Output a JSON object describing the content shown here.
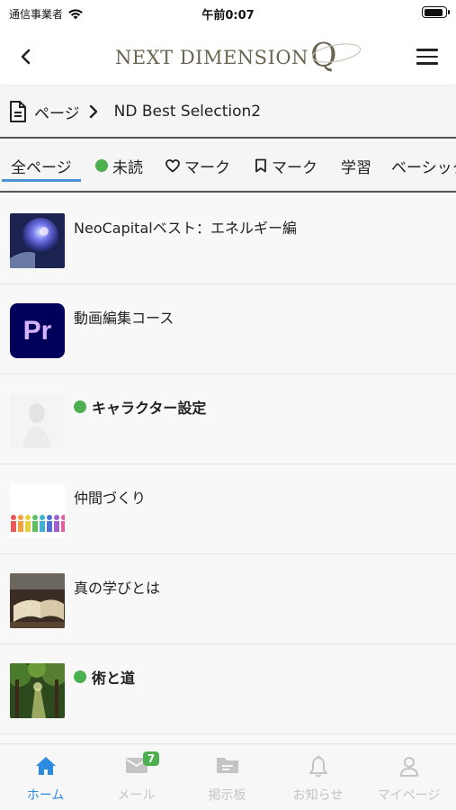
{
  "status_bar": {
    "carrier": "通信事業者",
    "time": "午前0:07",
    "battery_level": 0.9
  },
  "header": {
    "logo_text": "NEXT DIMENSION",
    "logo_q": "Q",
    "back_icon": "chevron-left-icon",
    "menu_icon": "hamburger-menu-icon"
  },
  "breadcrumb": {
    "root": "ページ",
    "current": "ND Best Selection2"
  },
  "tabs": [
    {
      "label": "全ページ",
      "active": true
    },
    {
      "label": "未読",
      "icon": "green-dot-icon"
    },
    {
      "label": "マーク",
      "icon": "heart-icon"
    },
    {
      "label": "マーク",
      "icon": "bookmark-icon"
    },
    {
      "label": "学習"
    },
    {
      "label": "ベーシック"
    }
  ],
  "items": [
    {
      "title": "NeoCapitalベスト：エネルギー編",
      "unread": false,
      "thumb": "energy-orb-image"
    },
    {
      "title": "動画編集コース",
      "unread": false,
      "thumb": "premiere-pro-logo",
      "thumb_text": "Pr"
    },
    {
      "title": "キャラクター設定",
      "unread": true,
      "thumb": "faded-figure-image"
    },
    {
      "title": "仲間づくり",
      "unread": false,
      "thumb": "colorful-people-image"
    },
    {
      "title": "真の学びとは",
      "unread": false,
      "thumb": "open-book-image"
    },
    {
      "title": "術と道",
      "unread": true,
      "thumb": "forest-path-image"
    }
  ],
  "bottom_nav": [
    {
      "label": "ホーム",
      "icon": "home-icon",
      "active": true
    },
    {
      "label": "メール",
      "icon": "mail-icon",
      "badge": "7"
    },
    {
      "label": "掲示板",
      "icon": "folder-icon"
    },
    {
      "label": "お知らせ",
      "icon": "bell-icon"
    },
    {
      "label": "マイページ",
      "icon": "person-icon"
    }
  ],
  "colors": {
    "accent": "#2b8be0",
    "unread_dot": "#4caf50",
    "logo": "#6a6550",
    "inactive_nav": "#c4c4c4"
  }
}
